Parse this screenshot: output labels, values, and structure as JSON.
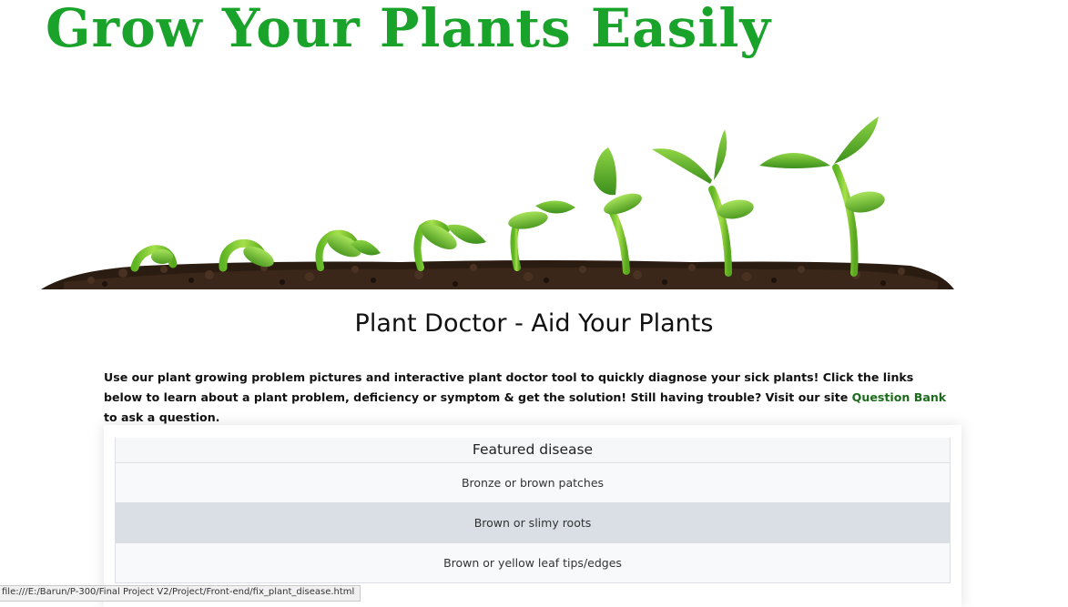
{
  "header": {
    "brand_title": "Grow Your Plants Easily"
  },
  "hero": {
    "image_name": "seedling-growth-stages-image"
  },
  "main": {
    "page_title": "Plant Doctor - Aid Your Plants",
    "intro_before_link": "Use our plant growing problem pictures and interactive plant doctor tool to quickly diagnose your sick plants! Click the links below to learn about a plant problem, deficiency or symptom & get the solution! Still having trouble? Visit our site ",
    "intro_link": "Question Bank",
    "intro_after_link": " to ask a question."
  },
  "featured": {
    "header": "Featured disease",
    "items": [
      {
        "label": "Bronze or brown patches"
      },
      {
        "label": "Brown or slimy roots",
        "active": true
      },
      {
        "label": "Brown or yellow leaf tips/edges"
      }
    ]
  },
  "status": {
    "url": "file:///E:/Barun/P-300/Final Project V2/Project/Front-end/fix_plant_disease.html"
  },
  "colors": {
    "brand_green": "#1aa32a",
    "link_green": "#1b6b1b",
    "active_item": "#dadee5"
  }
}
